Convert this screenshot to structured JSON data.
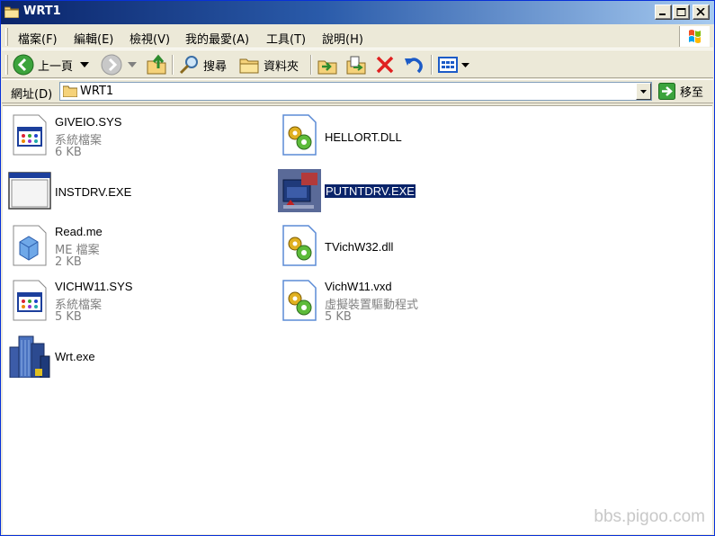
{
  "window": {
    "title": "WRT1"
  },
  "menu": {
    "items": [
      "檔案(F)",
      "編輯(E)",
      "檢視(V)",
      "我的最愛(A)",
      "工具(T)",
      "說明(H)"
    ]
  },
  "toolbar": {
    "back_label": "上一頁",
    "search_label": "搜尋",
    "folders_label": "資料夾"
  },
  "address": {
    "label": "網址(D)",
    "value": "WRT1",
    "go_label": "移至"
  },
  "files": [
    {
      "name": "GIVEIO.SYS",
      "type": "系統檔案",
      "size": "6 KB",
      "icon": "system-file-icon"
    },
    {
      "name": "HELLORT.DLL",
      "type": "",
      "size": "",
      "icon": "dll-gear-icon"
    },
    {
      "name": "INSTDRV.EXE",
      "type": "",
      "size": "",
      "icon": "window-exe-icon"
    },
    {
      "name": "PUTNTDRV.EXE",
      "type": "",
      "size": "",
      "icon": "app-exe-icon",
      "selected": true
    },
    {
      "name": "Read.me",
      "type": "ME 檔案",
      "size": "2 KB",
      "icon": "generic-file-icon"
    },
    {
      "name": "TVichW32.dll",
      "type": "",
      "size": "",
      "icon": "dll-gear-icon"
    },
    {
      "name": "VICHW11.SYS",
      "type": "系統檔案",
      "size": "5 KB",
      "icon": "system-file-icon"
    },
    {
      "name": "VichW11.vxd",
      "type": "虛擬裝置驅動程式",
      "size": "5 KB",
      "icon": "dll-gear-icon"
    },
    {
      "name": "Wrt.exe",
      "type": "",
      "size": "",
      "icon": "building-exe-icon"
    }
  ],
  "watermark": "bbs.pigoo.com",
  "colors": {
    "titlebar_start": "#0A246A",
    "titlebar_end": "#A6CAF0",
    "chrome": "#ECE9D8",
    "selection": "#0A246A"
  }
}
